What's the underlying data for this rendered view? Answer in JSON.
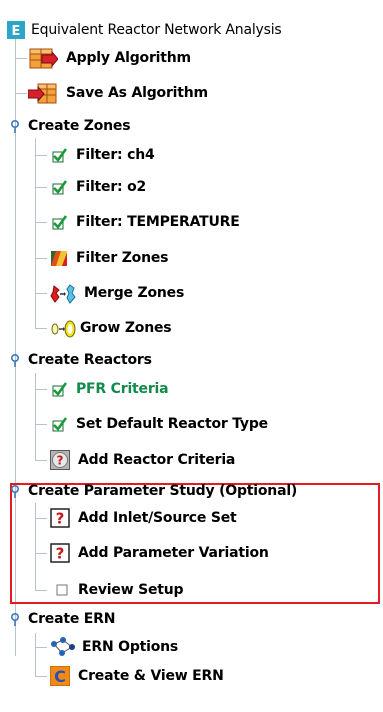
{
  "tree": {
    "root": {
      "label": "Equivalent Reactor Network Analysis",
      "icon": "root-e-icon"
    },
    "items": [
      {
        "label": "Apply Algorithm",
        "icon": "apply-algorithm-icon"
      },
      {
        "label": "Save As Algorithm",
        "icon": "save-algorithm-icon"
      },
      {
        "label": "Create Zones",
        "icon": "expanded-node-icon",
        "children": [
          {
            "label": "Filter: ch4",
            "icon": "checkmark-icon"
          },
          {
            "label": "Filter: o2",
            "icon": "checkmark-icon"
          },
          {
            "label": "Filter: TEMPERATURE",
            "icon": "checkmark-icon"
          },
          {
            "label": "Filter Zones",
            "icon": "filter-zones-icon"
          },
          {
            "label": "Merge Zones",
            "icon": "merge-zones-icon"
          },
          {
            "label": "Grow Zones",
            "icon": "grow-zones-icon"
          }
        ]
      },
      {
        "label": "Create Reactors",
        "icon": "expanded-node-icon",
        "children": [
          {
            "label": "PFR Criteria",
            "icon": "checkmark-icon",
            "color": "#138a4b"
          },
          {
            "label": "Set Default Reactor Type",
            "icon": "checkmark-icon"
          },
          {
            "label": "Add Reactor Criteria",
            "icon": "question-circle-icon"
          }
        ]
      },
      {
        "label": "Create Parameter Study (Optional)",
        "icon": "expanded-node-icon",
        "highlight_color": "#e31b23",
        "children": [
          {
            "label": "Add Inlet/Source Set",
            "icon": "question-box-icon"
          },
          {
            "label": "Add Parameter Variation",
            "icon": "question-box-icon"
          },
          {
            "label": "Review Setup",
            "icon": "empty-square-icon"
          }
        ]
      },
      {
        "label": "Create ERN",
        "icon": "expanded-node-icon",
        "children": [
          {
            "label": "ERN Options",
            "icon": "network-options-icon"
          },
          {
            "label": "Create & View ERN",
            "icon": "create-ern-icon"
          }
        ]
      }
    ]
  }
}
